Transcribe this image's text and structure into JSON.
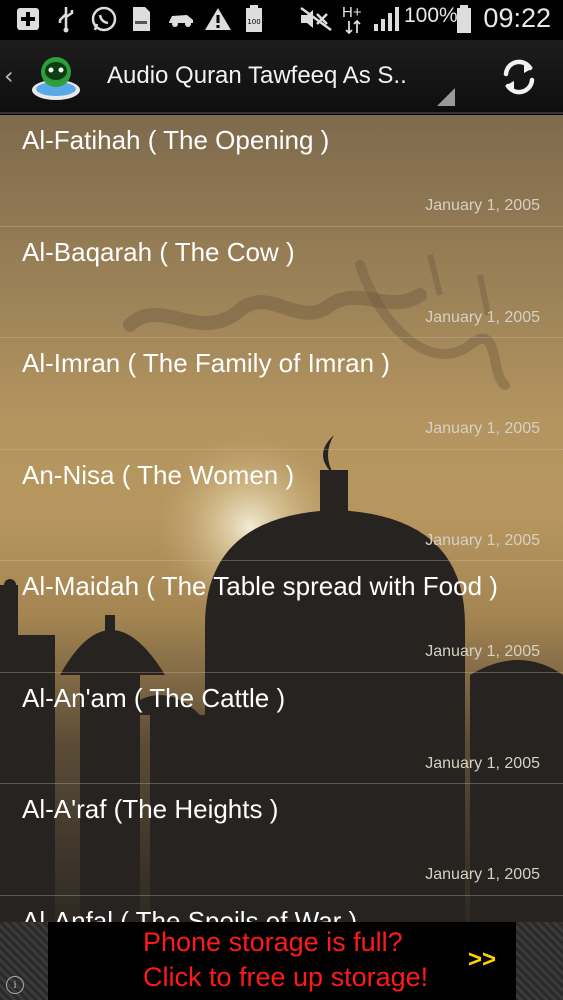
{
  "status_bar": {
    "battery_percent": "100%",
    "time": "09:22",
    "network_label": "H+",
    "icons": [
      "add-icon",
      "usb-icon",
      "whatsapp-icon",
      "sd-card-icon",
      "car-icon",
      "warning-icon",
      "battery-saver-icon",
      "mute-icon",
      "network-icon",
      "signal-icon",
      "battery-icon"
    ]
  },
  "action_bar": {
    "title": "Audio Quran Tawfeeq As S..",
    "up_icon": "chevron-left-icon",
    "app_icon": "app-logo-icon",
    "refresh_icon": "refresh-icon"
  },
  "surahs": [
    {
      "title": "Al-Fatihah ( The Opening )",
      "date": "January 1, 2005"
    },
    {
      "title": "Al-Baqarah ( The Cow )",
      "date": "January 1, 2005"
    },
    {
      "title": "Al-Imran ( The Family of Imran )",
      "date": "January 1, 2005"
    },
    {
      "title": "An-Nisa ( The Women )",
      "date": "January 1, 2005"
    },
    {
      "title": "Al-Maidah ( The Table spread with Food )",
      "date": "January 1, 2005"
    },
    {
      "title": "Al-An'am ( The Cattle )",
      "date": "January 1, 2005"
    },
    {
      "title": "Al-A'raf (The Heights )",
      "date": "January 1, 2005"
    },
    {
      "title": "Al-Anfal ( The Spoils of War )",
      "date": ""
    }
  ],
  "ad": {
    "line1": "Phone storage is full?",
    "line2": "Click to free up storage!",
    "arrow": ">>",
    "info": "i"
  },
  "colors": {
    "ad_text": "#ff1a1a",
    "ad_arrow": "#ffd400",
    "action_bar": "#151515"
  }
}
